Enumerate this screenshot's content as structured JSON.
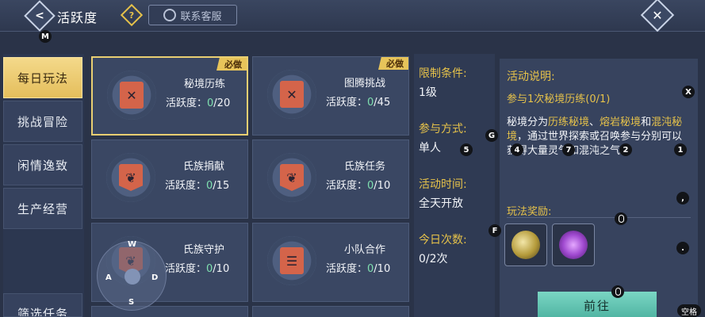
{
  "header": {
    "back_label": "<",
    "title": "活跃度",
    "help_glyph": "?",
    "service_label": "联系客服",
    "close_label": "✕"
  },
  "keys": {
    "m": "M",
    "x": "X",
    "g": "G",
    "five": "5",
    "four": "4",
    "seven": "7",
    "two": "2",
    "one": "1",
    "f": "F",
    "comma": ",",
    "period": ".",
    "space": "空格",
    "w": "W",
    "a": "A",
    "s": "S",
    "d": "D"
  },
  "sidebar": {
    "items": [
      {
        "label": "每日玩法",
        "active": true
      },
      {
        "label": "挑战冒险",
        "active": false
      },
      {
        "label": "闲情逸致",
        "active": false
      },
      {
        "label": "生产经营",
        "active": false
      },
      {
        "label": "筛选任务",
        "active": false
      }
    ]
  },
  "activities": [
    {
      "name": "秘境历练",
      "label": "活跃度：",
      "current": "0",
      "total": "/20",
      "required": "必做",
      "icon": "crossed-staves-icon",
      "selected": true
    },
    {
      "name": "图腾挑战",
      "label": "活跃度：",
      "current": "0",
      "total": "/45",
      "required": "必做",
      "icon": "crossed-axes-icon",
      "selected": false
    },
    {
      "name": "氏族捐献",
      "label": "活跃度：",
      "current": "0",
      "total": "/15",
      "required": "",
      "icon": "clan-banner-icon",
      "selected": false
    },
    {
      "name": "氏族任务",
      "label": "活跃度：",
      "current": "0",
      "total": "/10",
      "required": "",
      "icon": "clan-banner-icon",
      "selected": false
    },
    {
      "name": "氏族守护",
      "label": "活跃度：",
      "current": "0",
      "total": "/10",
      "required": "",
      "icon": "clan-banner-icon",
      "selected": false
    },
    {
      "name": "小队合作",
      "label": "活跃度：",
      "current": "0",
      "total": "/10",
      "required": "",
      "icon": "notice-board-icon",
      "selected": false
    }
  ],
  "conditions": {
    "limit_label": "限制条件:",
    "limit_value": "1级",
    "mode_label": "参与方式:",
    "mode_value": "单人",
    "time_label": "活动时间:",
    "time_value": "全天开放",
    "count_label": "今日次数:",
    "count_value": "0/2次"
  },
  "description": {
    "heading": "活动说明:",
    "subtitle": "参与1次秘境历练(0/1)",
    "text_1": "秘境分为",
    "hl_1": "历练秘境",
    "sep_1": "、",
    "hl_2": "熔岩秘境",
    "text_2": "和",
    "hl_3": "混沌秘境",
    "text_3": "，通过世界探索或召唤参与分别可以获得大量灵气和混沌之气。",
    "reward_label": "玩法奖励:",
    "go_label": "前往"
  },
  "colors": {
    "accent_gold": "#e6c24a",
    "progress_green": "#7fe0b0",
    "go_button": "#4fb4a2"
  }
}
